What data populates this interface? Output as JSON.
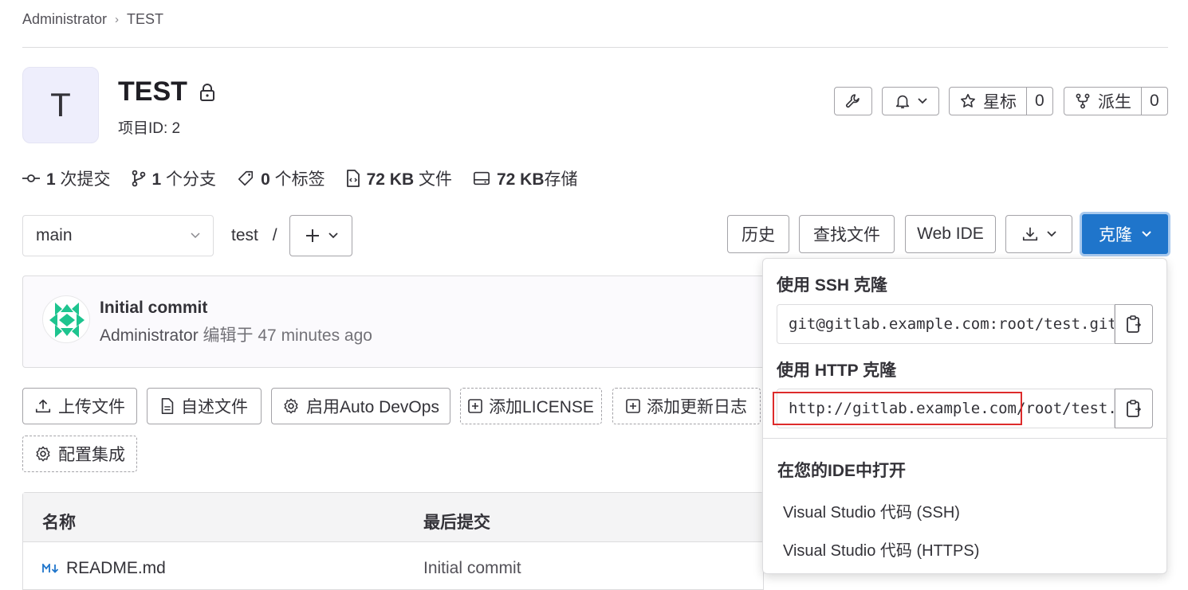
{
  "breadcrumb": {
    "parent": "Administrator",
    "current": "TEST"
  },
  "project": {
    "avatar_letter": "T",
    "name": "TEST",
    "id_label": "项目ID: 2"
  },
  "actions": {
    "star_label": "星标",
    "star_count": "0",
    "fork_label": "派生",
    "fork_count": "0"
  },
  "stats": {
    "commits_num": "1",
    "commits_label": " 次提交",
    "branches_num": "1",
    "branches_label": " 个分支",
    "tags_num": "0",
    "tags_label": " 个标签",
    "files_num": "72 KB",
    "files_label": " 文件",
    "storage_num": "72 KB",
    "storage_label": "存储"
  },
  "toolbar": {
    "branch": "main",
    "path": "test",
    "path_sep": "/",
    "history": "历史",
    "find_file": "查找文件",
    "web_ide": "Web IDE",
    "clone": "克隆"
  },
  "last_commit": {
    "title": "Initial commit",
    "author": "Administrator",
    "action": " 编辑于 ",
    "time": "47 minutes ago"
  },
  "quick_actions": {
    "upload": "上传文件",
    "readme": "自述文件",
    "auto_devops": "启用Auto DevOps",
    "license": "添加LICENSE",
    "changelog": "添加更新日志",
    "integrations": "配置集成"
  },
  "file_table": {
    "headers": [
      "名称",
      "最后提交"
    ],
    "rows": [
      {
        "name": "README.md",
        "commit": "Initial commit"
      }
    ]
  },
  "clone_dropdown": {
    "ssh_label": "使用 SSH 克隆",
    "ssh_url": "git@gitlab.example.com:root/test.git",
    "http_label": "使用 HTTP 克隆",
    "http_url": "http://gitlab.example.com/root/test.git",
    "ide_label": "在您的IDE中打开",
    "ide_items": [
      "Visual Studio 代码 (SSH)",
      "Visual Studio 代码 (HTTPS)"
    ]
  },
  "colors": {
    "primary": "#1f75cb",
    "highlight": "#dd2b2b"
  }
}
